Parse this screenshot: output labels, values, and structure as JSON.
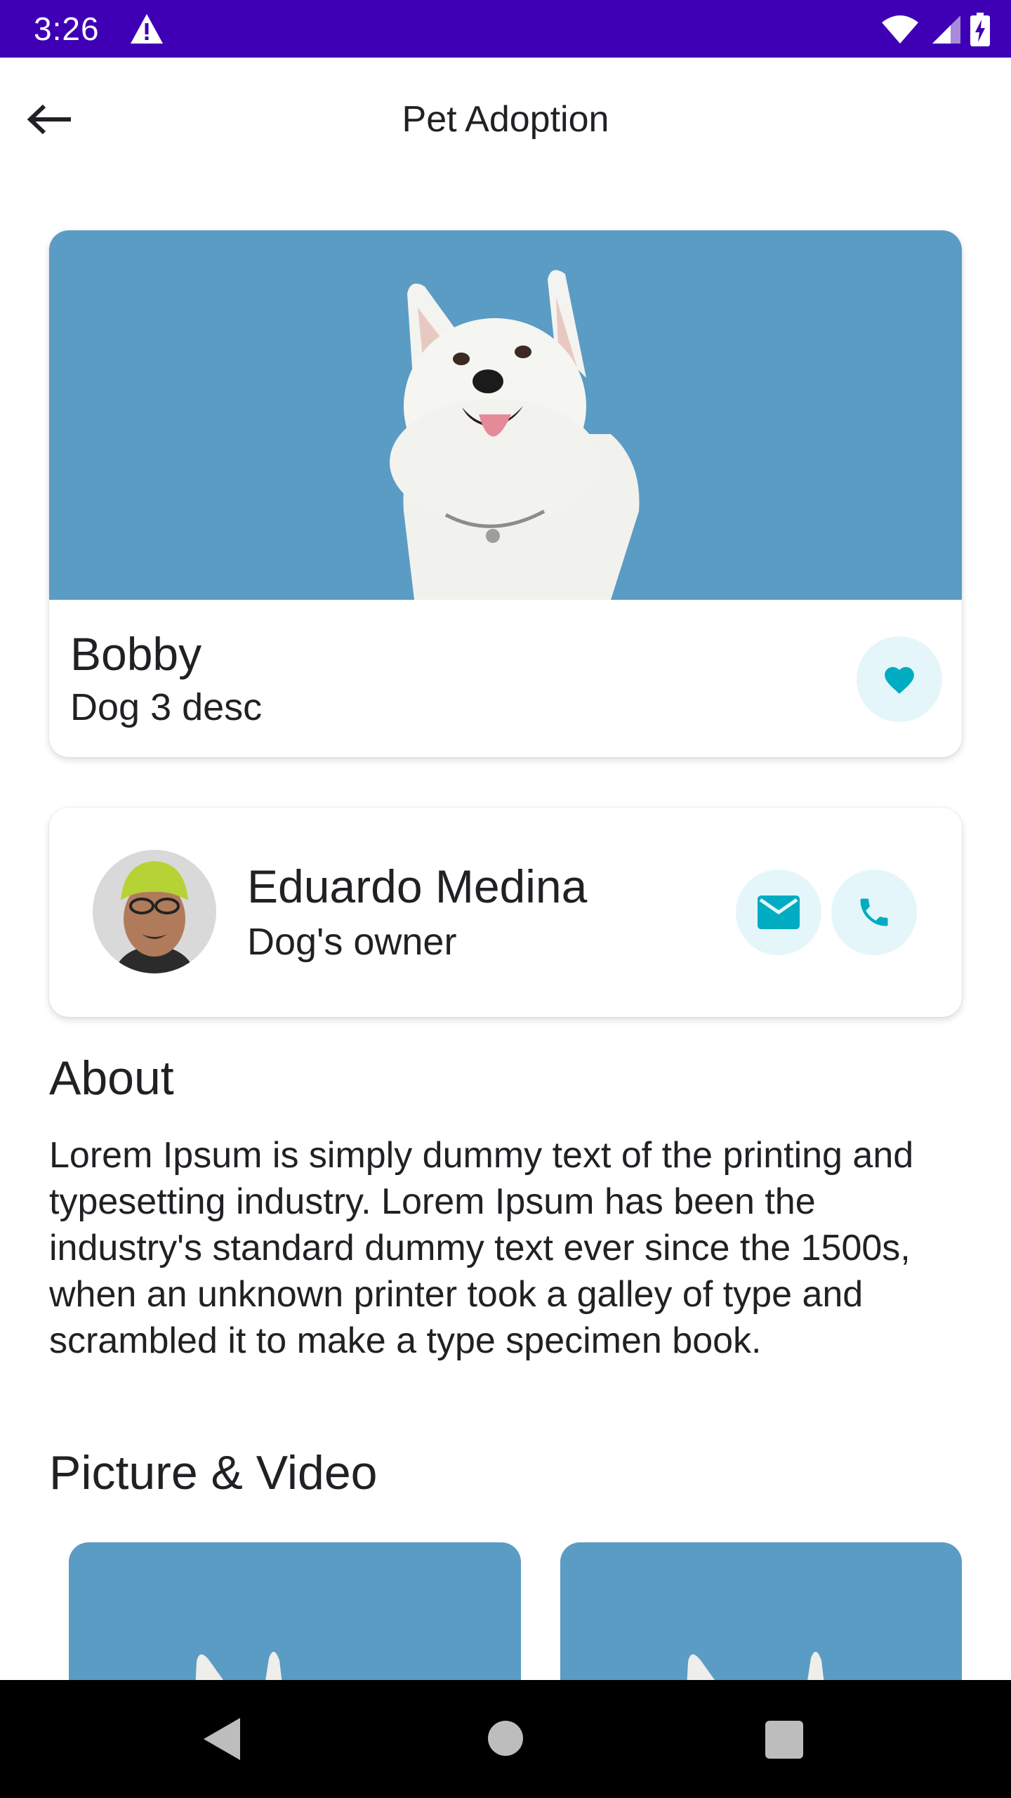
{
  "status_bar": {
    "time": "3:26",
    "background": "#3f00b5",
    "icons": [
      "warning-icon",
      "wifi-icon",
      "cellular-signal-icon",
      "battery-charging-icon"
    ]
  },
  "app_bar": {
    "title": "Pet Adoption",
    "back_icon": "arrow-back-icon"
  },
  "pet": {
    "name": "Bobby",
    "description": "Dog 3 desc",
    "photo": "white-husky-dog",
    "photo_background": "#5a9cc4",
    "favorite_icon": "heart-icon"
  },
  "owner": {
    "name": "Eduardo Medina",
    "role": "Dog's owner",
    "email_icon": "email-icon",
    "phone_icon": "phone-icon"
  },
  "about": {
    "title": "About",
    "text": "Lorem Ipsum is simply dummy text of the printing and typesetting industry. Lorem Ipsum has been the industry's standard dummy text ever since the 1500s, when an unknown printer took a galley of type and scrambled it to make a type specimen book."
  },
  "media": {
    "title": "Picture & Video",
    "items": [
      "dog-photo",
      "dog-photo"
    ]
  },
  "colors": {
    "accent": "#00acc1",
    "accent_bg": "#e5f6fb"
  },
  "nav_bar": {
    "icons": [
      "nav-back-icon",
      "nav-home-icon",
      "nav-recents-icon"
    ]
  }
}
